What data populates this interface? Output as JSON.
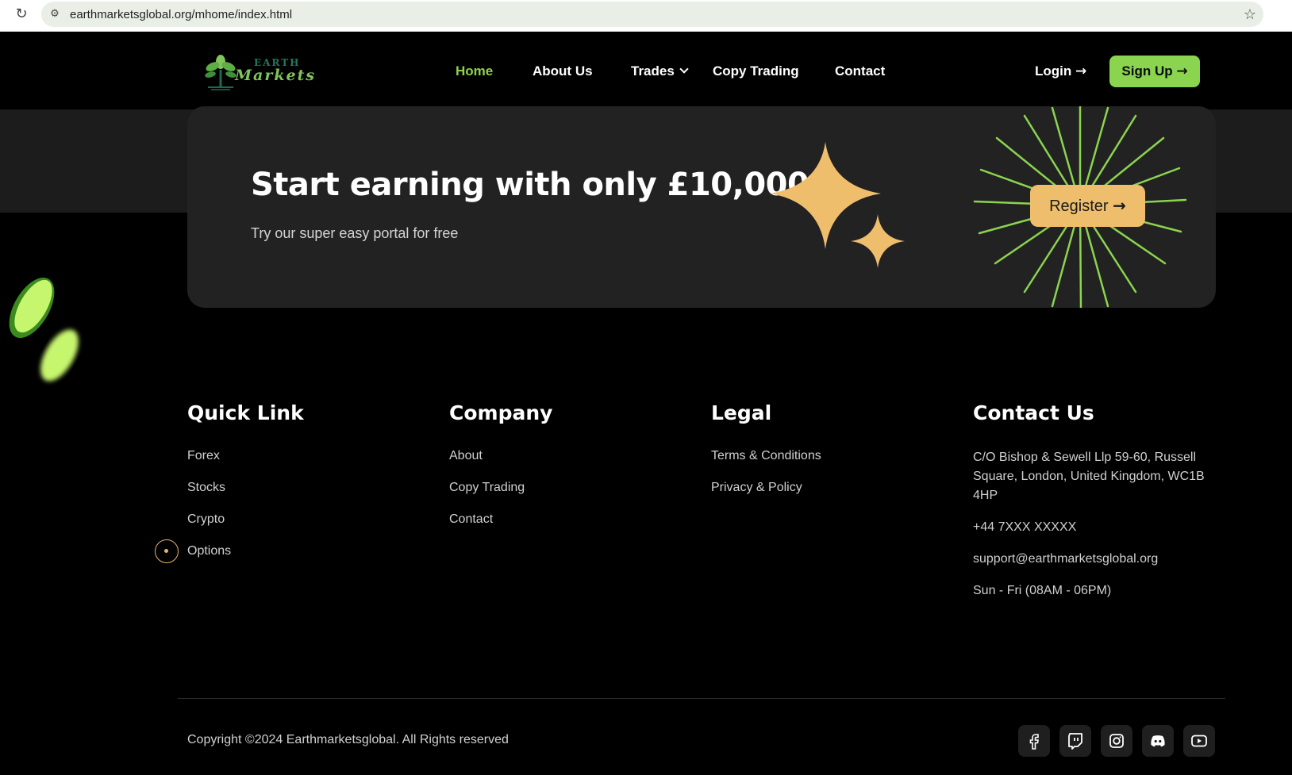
{
  "browser": {
    "url": "earthmarketsglobal.org/mhome/index.html"
  },
  "nav": {
    "logo_top": "EARTH",
    "logo_bottom": "Markets",
    "links": [
      "Home",
      "About Us",
      "Trades",
      "Copy Trading",
      "Contact"
    ],
    "login_label": "Login",
    "signup_label": "Sign Up"
  },
  "cta": {
    "title": "Start earning with only £10,000",
    "subtitle": "Try our super easy portal for free",
    "register_label": "Register"
  },
  "footer": {
    "quick_link": {
      "title": "Quick Link",
      "items": [
        "Forex",
        "Stocks",
        "Crypto",
        "Options"
      ]
    },
    "company": {
      "title": "Company",
      "items": [
        "About",
        "Copy Trading",
        "Contact"
      ]
    },
    "legal": {
      "title": "Legal",
      "items": [
        "Terms & Conditions",
        "Privacy & Policy"
      ]
    },
    "contact": {
      "title": "Contact Us",
      "address": "C/O Bishop & Sewell Llp 59-60, Russell Square, London, United Kingdom, WC1B 4HP",
      "phone": "+44 7XXX XXXXX",
      "email": "support@earthmarketsglobal.org",
      "hours": "Sun - Fri (08AM - 06PM)"
    },
    "copyright": "Copyright ©2024 Earthmarketsglobal. All Rights reserved",
    "social_icons": [
      "facebook-icon",
      "twitch-icon",
      "instagram-icon",
      "discord-icon",
      "youtube-icon"
    ]
  },
  "colors": {
    "accent_green": "#8bd44f",
    "accent_gold": "#efbe6d",
    "background": "#000000",
    "card": "#222222"
  }
}
